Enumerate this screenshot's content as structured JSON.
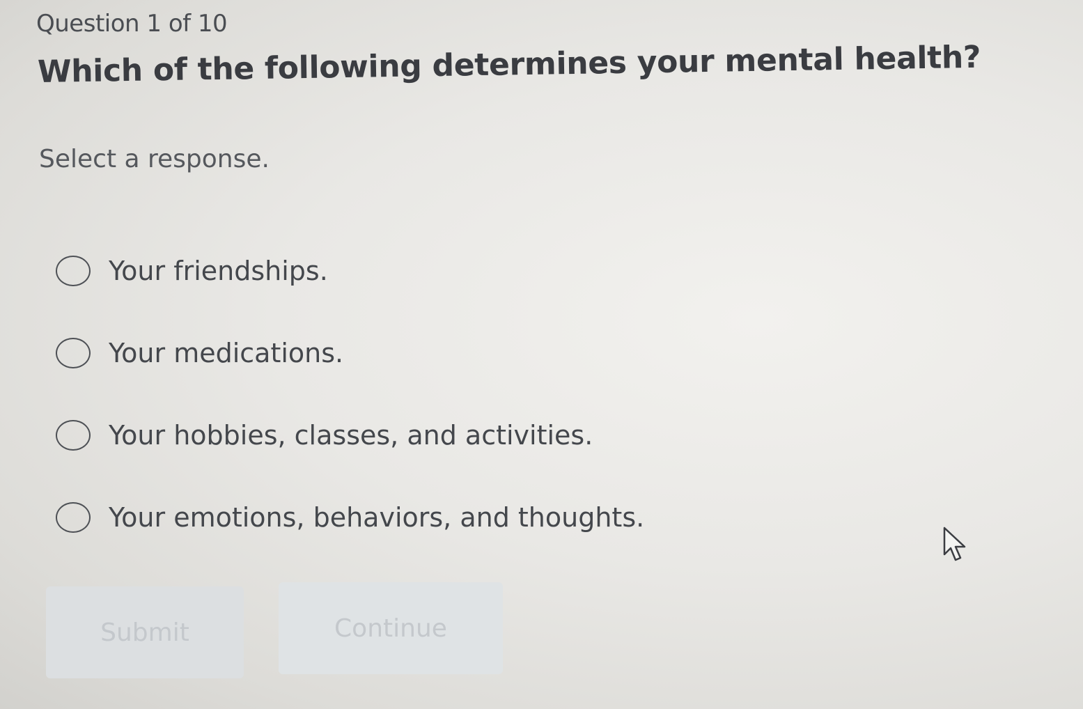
{
  "quiz": {
    "counter": "Question 1 of 10",
    "question": "Which of the following determines your mental health?",
    "instruction": "Select a response.",
    "options": [
      {
        "label": "Your friendships."
      },
      {
        "label": "Your medications."
      },
      {
        "label": "Your hobbies, classes, and activities."
      },
      {
        "label": "Your emotions, behaviors, and thoughts."
      }
    ]
  },
  "actions": {
    "submit_label": "Submit",
    "continue_label": "Continue",
    "submit_disabled": true,
    "continue_disabled": true
  },
  "icons": {
    "pointer": "mouse-pointer-icon",
    "radio": "radio-unchecked-icon"
  },
  "colors": {
    "text": "#3f4247",
    "disabled_button": "#dcdfe1",
    "disabled_text": "#c4c8cc"
  }
}
